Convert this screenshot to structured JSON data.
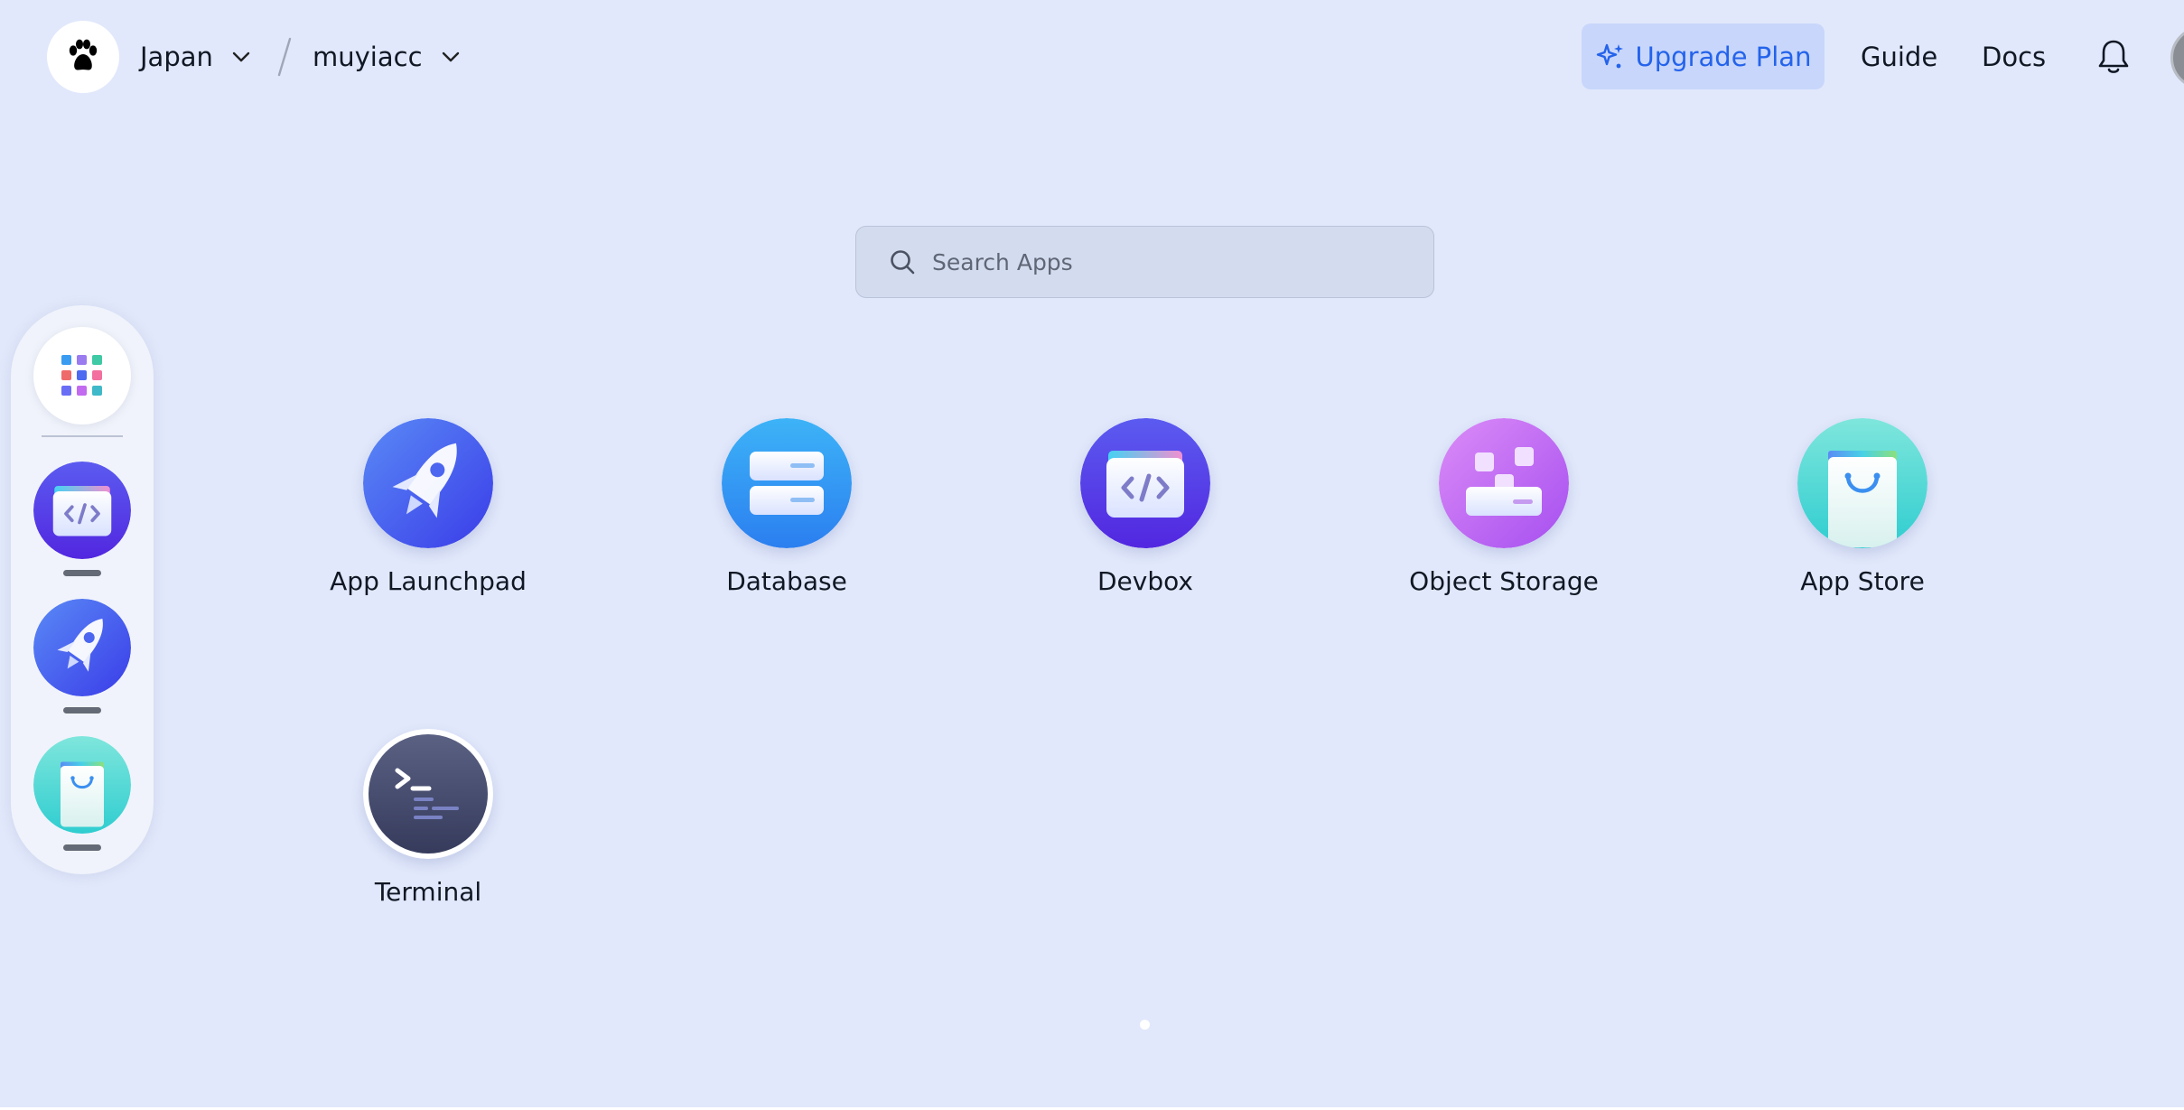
{
  "header": {
    "logo_icon": "paw-logo-icon",
    "region": "Japan",
    "namespace": "muyiacc",
    "upgrade_label": "Upgrade Plan",
    "guide_label": "Guide",
    "docs_label": "Docs",
    "notifications_icon": "bell-icon"
  },
  "search": {
    "placeholder": "Search Apps",
    "value": ""
  },
  "dock": {
    "items": [
      {
        "name": "app-grid",
        "icon": "apps-grid-icon",
        "running": false
      },
      {
        "name": "Devbox",
        "icon": "devbox-icon",
        "running": true
      },
      {
        "name": "App Launchpad",
        "icon": "rocket-icon",
        "running": true
      },
      {
        "name": "App Store",
        "icon": "shopping-bag-icon",
        "running": true
      }
    ]
  },
  "apps": [
    {
      "label": "App Launchpad",
      "icon": "rocket-icon"
    },
    {
      "label": "Database",
      "icon": "database-icon"
    },
    {
      "label": "Devbox",
      "icon": "devbox-icon"
    },
    {
      "label": "Object Storage",
      "icon": "object-storage-icon"
    },
    {
      "label": "App Store",
      "icon": "shopping-bag-icon"
    },
    {
      "label": "Terminal",
      "icon": "terminal-icon"
    }
  ],
  "pagination": {
    "pages": 1,
    "current": 1
  },
  "colors": {
    "background": "#e1e8fb",
    "accent": "#2463eb",
    "upgrade_bg": "#c8d6fb"
  }
}
